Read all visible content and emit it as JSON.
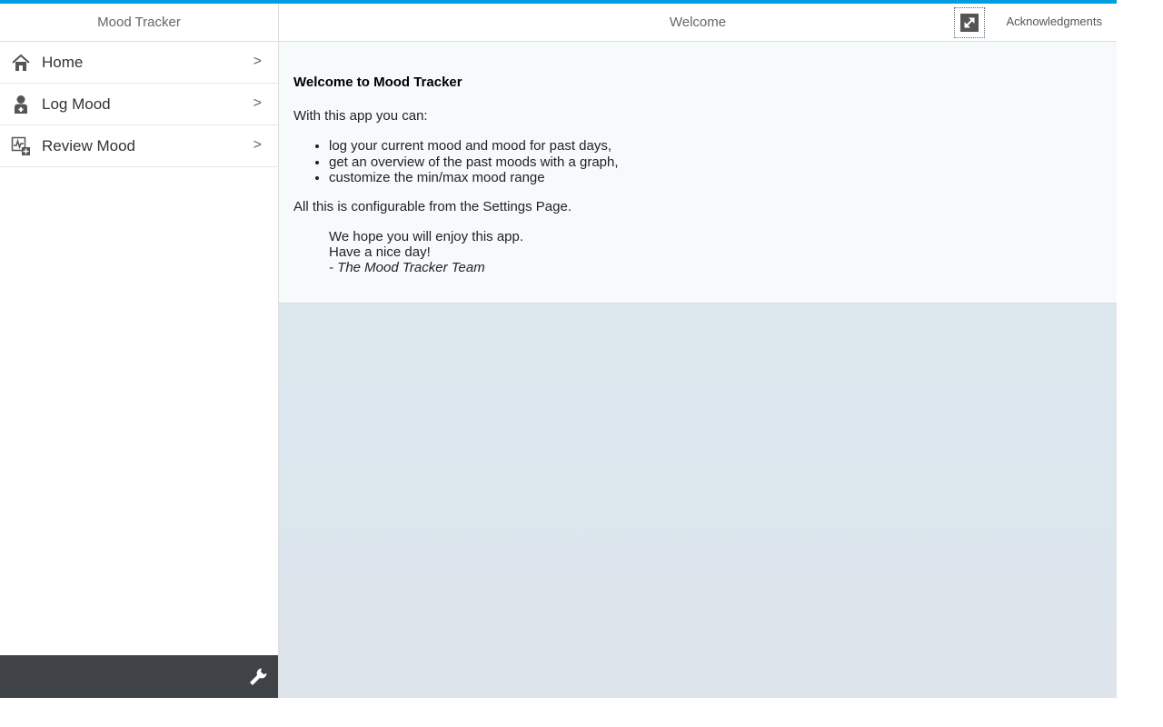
{
  "master": {
    "title": "Mood Tracker",
    "items": [
      {
        "label": "Home",
        "icon": "home-icon",
        "chevron": ">"
      },
      {
        "label": "Log Mood",
        "icon": "doctor-icon",
        "chevron": ">"
      },
      {
        "label": "Review Mood",
        "icon": "chart-add-icon",
        "chevron": ">"
      }
    ],
    "footer": {
      "icon": "wrench-icon"
    }
  },
  "detail": {
    "title": "Welcome",
    "fullscreen_icon": "expand-icon",
    "acknowledgments_label": "Acknowledgments",
    "content": {
      "heading": "Welcome to Mood Tracker",
      "intro": "With this app you can:",
      "features": [
        "log your current mood and mood for past days,",
        "get an overview of the past moods with a graph,",
        "customize the min/max mood range"
      ],
      "config_text": "All this is configurable from the Settings Page.",
      "signoff": [
        "We hope you will enjoy this app.",
        "Have a nice day!",
        "- The Mood Tracker Team"
      ]
    }
  },
  "colors": {
    "accent": "#009de0",
    "footer_bg": "#3f4347",
    "panel_bg": "#f7fafb"
  }
}
